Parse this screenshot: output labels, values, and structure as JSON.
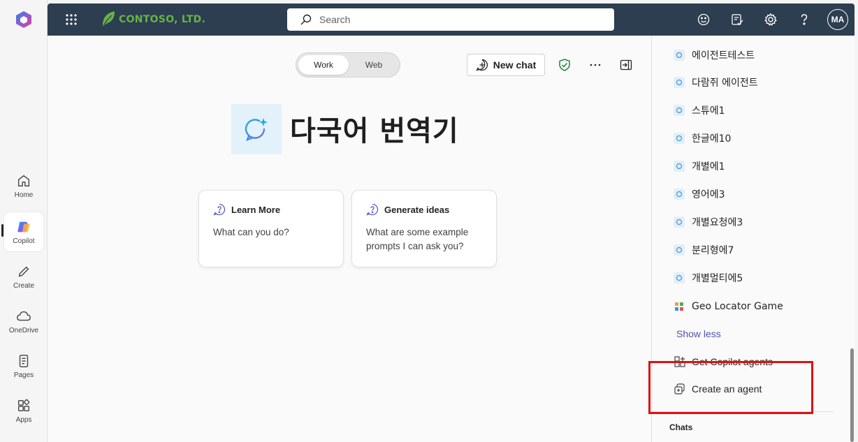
{
  "rail": {
    "items": [
      {
        "label": "Home",
        "icon": "home-icon"
      },
      {
        "label": "Copilot",
        "icon": "copilot-icon"
      },
      {
        "label": "Create",
        "icon": "pen-icon"
      },
      {
        "label": "OneDrive",
        "icon": "cloud-icon"
      },
      {
        "label": "Pages",
        "icon": "pages-icon"
      },
      {
        "label": "Apps",
        "icon": "apps-icon"
      }
    ],
    "active": "Copilot"
  },
  "header": {
    "brand": "CONTOSO, LTD.",
    "search_placeholder": "Search",
    "avatar_initials": "MA",
    "icons": [
      "smiley-icon",
      "checklist-icon",
      "gear-icon",
      "help-icon"
    ]
  },
  "main": {
    "toggle": {
      "work": "Work",
      "web": "Web",
      "selected": "Work"
    },
    "new_chat_label": "New chat",
    "agent_title": "다국어 번역기",
    "cards": [
      {
        "title": "Learn More",
        "body": "What can you do?"
      },
      {
        "title": "Generate ideas",
        "body": "What are some example prompts I can ask you?"
      }
    ]
  },
  "panel": {
    "partial_top_item": "에이전트테스트",
    "agents": [
      "다람쥐 에이전트",
      "스튜에1",
      "한글에10",
      "개별에1",
      "영어에3",
      "개별요청에3",
      "분리형에7",
      "개별멀티에5",
      "Geo Locator Game"
    ],
    "show_less": "Show less",
    "get_agents": "Get Copilot agents",
    "create_agent": "Create an agent",
    "chats_label": "Chats"
  },
  "colors": {
    "header_bg": "#2c3e50",
    "brand_green": "#67b346",
    "link": "#4f52b2",
    "highlight": "#e01010"
  }
}
